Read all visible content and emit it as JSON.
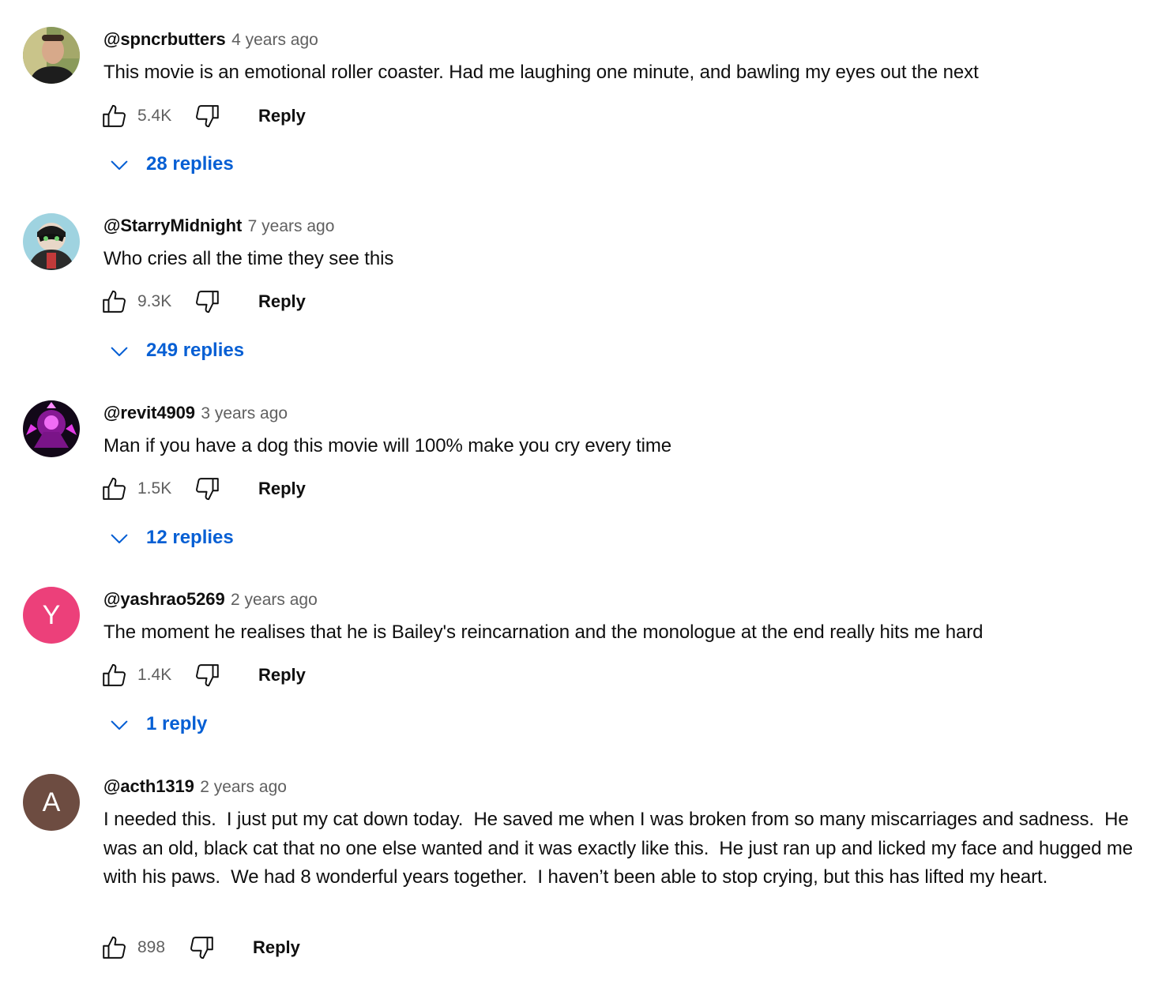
{
  "colors": {
    "link_blue": "#065fd4",
    "muted_text": "#606060",
    "primary_text": "#0f0f0f",
    "avatar_y": "#ec407a",
    "avatar_a": "#6d4c41"
  },
  "icons": {
    "like": "thumb-up-outline-icon",
    "dislike": "thumb-down-outline-icon",
    "expand": "chevron-down-icon"
  },
  "comments": [
    {
      "author": "@spncrbutters",
      "time": "4 years ago",
      "text": "This movie is an emotional roller coaster. Had me laughing one minute, and bawling my eyes out the next",
      "likes": "5.4K",
      "reply_label": "Reply",
      "replies_label": "28 replies"
    },
    {
      "author": "@StarryMidnight",
      "time": "7 years ago",
      "text": "Who cries all the time they see this",
      "likes": "9.3K",
      "reply_label": "Reply",
      "replies_label": "249 replies"
    },
    {
      "author": "@revit4909",
      "time": "3 years ago",
      "text": "Man if you have a dog this movie will 100% make you cry every time",
      "likes": "1.5K",
      "reply_label": "Reply",
      "replies_label": "12 replies"
    },
    {
      "author": "@yashrao5269",
      "time": "2 years ago",
      "text": "The moment he realises that he is Bailey's reincarnation and the monologue at the end really hits me hard",
      "likes": "1.4K",
      "reply_label": "Reply",
      "replies_label": "1 reply",
      "avatar_letter": "Y"
    },
    {
      "author": "@acth1319",
      "time": "2 years ago",
      "text": "I needed this.  I just put my cat down today.  He saved me when I was broken from so many miscarriages and sadness.  He was an old, black cat that no one else wanted and it was exactly like this.  He just ran up and licked my face and hugged me with his paws.  We had 8 wonderful years together.  I haven’t been able to stop crying, but this has lifted my heart.",
      "likes": "898",
      "reply_label": "Reply",
      "avatar_letter": "A"
    }
  ]
}
